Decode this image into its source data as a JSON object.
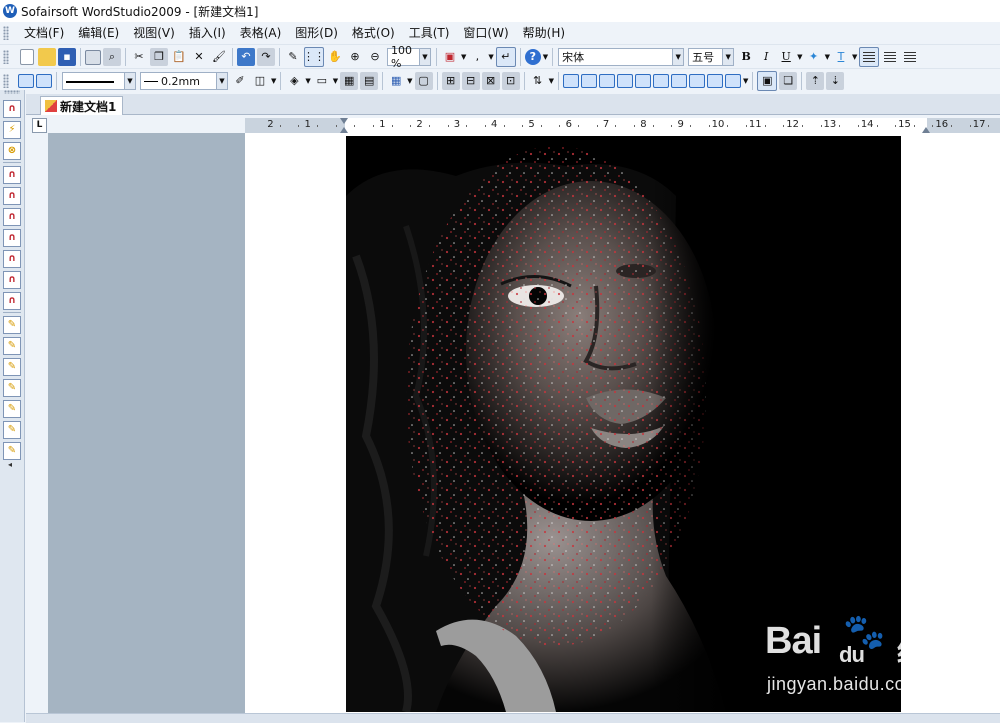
{
  "window": {
    "title": "Sofairsoft WordStudio2009 - [新建文档1]"
  },
  "menu": [
    "文档(F)",
    "编辑(E)",
    "视图(V)",
    "插入(I)",
    "表格(A)",
    "图形(D)",
    "格式(O)",
    "工具(T)",
    "窗口(W)",
    "帮助(H)"
  ],
  "toolbar1": {
    "zoom": "100 %",
    "font": "宋体",
    "size": "五号",
    "bold": "B",
    "italic": "I",
    "underline": "U"
  },
  "toolbar2": {
    "line_width": "0.2mm"
  },
  "tabs": [
    {
      "label": "新建文档1",
      "active": true
    }
  ],
  "ruler": {
    "corner": "L",
    "labels": [
      "2",
      "1",
      "1",
      "2",
      "3",
      "4",
      "5",
      "6",
      "7",
      "8",
      "9",
      "10",
      "11",
      "12",
      "13",
      "14",
      "15",
      "16",
      "17"
    ]
  },
  "watermark": {
    "logo_left": "Bai",
    "logo_right": "du",
    "brand_cn": "经验",
    "url": "jingyan.baidu.com"
  }
}
